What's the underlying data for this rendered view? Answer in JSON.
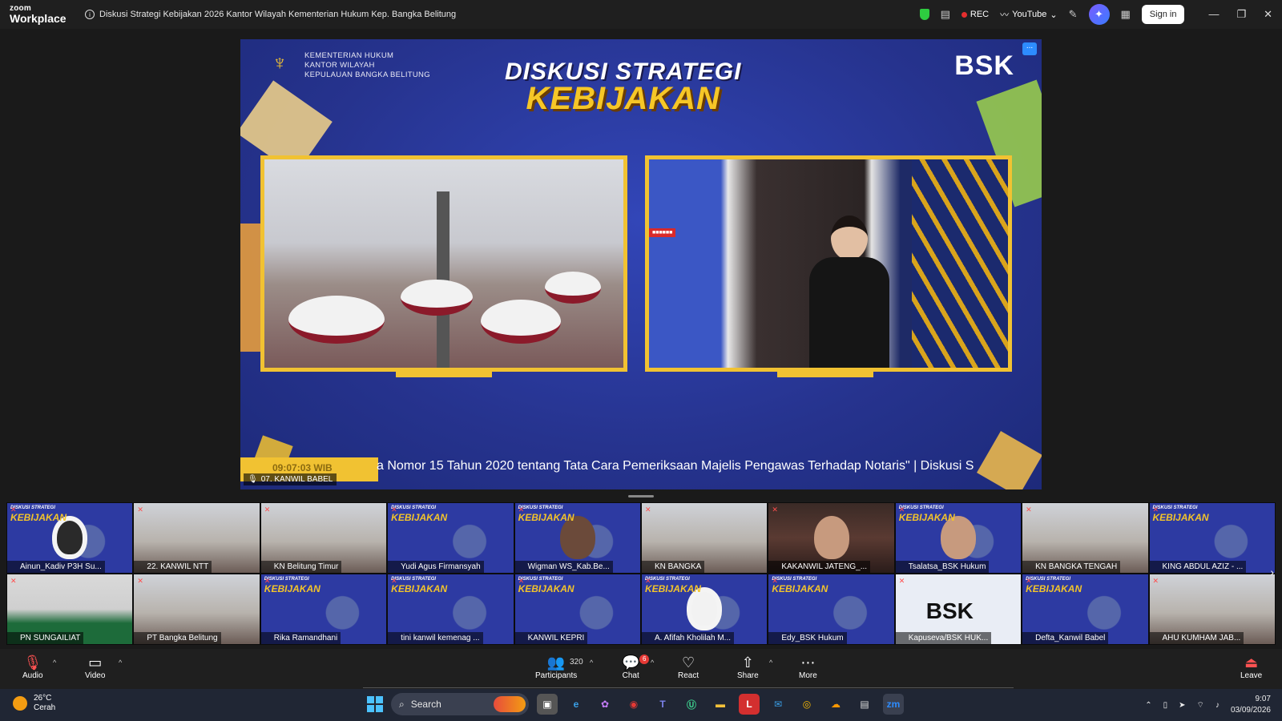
{
  "app": {
    "brand_line1": "zoom",
    "brand_line2": "Workplace"
  },
  "meeting": {
    "title": "Diskusi Strategi Kebijakan 2026 Kantor Wilayah Kementerian Hukum Kep. Bangka Belitung"
  },
  "titlebar": {
    "rec_label": "REC",
    "youtube_label": "YouTube",
    "signin_label": "Sign in"
  },
  "main_video": {
    "org_line1": "KEMENTERIAN HUKUM",
    "org_line2": "KANTOR WILAYAH",
    "org_line3": "KEPULAUAN BANGKA BELITUNG",
    "title_line1": "DISKUSI STRATEGI",
    "title_line2": "KEBIJAKAN",
    "brand": "BSK",
    "more_label": "...",
    "ticker_time": "09:07:03 WIB",
    "ticker_text": "a Nomor 15 Tahun 2020 tentang Tata Cara Pemeriksaan Majelis Pengawas Terhadap Notaris\" | Diskusi S",
    "speaker_label": "07. KANWIL BABEL"
  },
  "participants": [
    {
      "name": "Ainun_Kadiv P3H Su..."
    },
    {
      "name": "22. KANWIL NTT"
    },
    {
      "name": "KN Belitung Timur"
    },
    {
      "name": "Yudi Agus Firmansyah"
    },
    {
      "name": "Wigman WS_Kab.Be..."
    },
    {
      "name": "KN BANGKA"
    },
    {
      "name": "KAKANWIL JATENG_..."
    },
    {
      "name": "Tsalatsa_BSK Hukum"
    },
    {
      "name": "KN BANGKA TENGAH"
    },
    {
      "name": "KING ABDUL AZIZ - ..."
    },
    {
      "name": "PN SUNGAILIAT"
    },
    {
      "name": "PT Bangka Belitung"
    },
    {
      "name": "Rika Ramandhani"
    },
    {
      "name": "tini kanwil kemenag ..."
    },
    {
      "name": "KANWIL KEPRI"
    },
    {
      "name": "A. Afifah Kholilah M..."
    },
    {
      "name": "Edy_BSK Hukum"
    },
    {
      "name": "Kapuseva/BSK HUK..."
    },
    {
      "name": "Defta_Kanwil Babel"
    },
    {
      "name": "AHU KUMHAM JAB..."
    }
  ],
  "toolbar": {
    "audio": "Audio",
    "video": "Video",
    "participants": "Participants",
    "participant_count": "320",
    "chat": "Chat",
    "chat_badge": "6",
    "react": "React",
    "share": "Share",
    "more": "More",
    "leave": "Leave"
  },
  "taskbar": {
    "temp": "26°C",
    "weather": "Cerah",
    "search_placeholder": "Search",
    "time": "9:07",
    "date": "03/09/2026"
  },
  "colors": {
    "accent": "#2d8cff",
    "banner_yellow": "#f1c232",
    "banner_blue": "#2a3899",
    "leave_red": "#ff5252"
  }
}
